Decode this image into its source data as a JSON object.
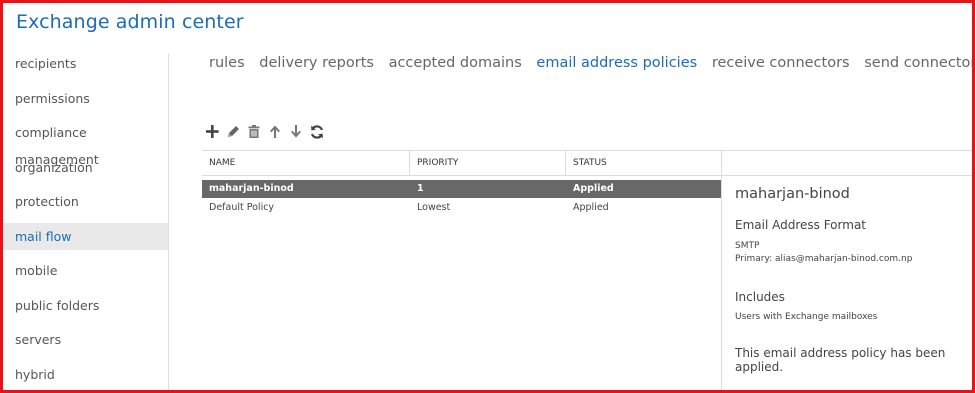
{
  "app": {
    "title": "Exchange admin center"
  },
  "sidebar": {
    "items": [
      {
        "label": "recipients"
      },
      {
        "label": "permissions"
      },
      {
        "label": "compliance management"
      },
      {
        "label": "organization"
      },
      {
        "label": "protection"
      },
      {
        "label": "mail flow",
        "active": true
      },
      {
        "label": "mobile"
      },
      {
        "label": "public folders"
      },
      {
        "label": "servers"
      },
      {
        "label": "hybrid"
      }
    ]
  },
  "tabs": [
    {
      "label": "rules"
    },
    {
      "label": "delivery reports"
    },
    {
      "label": "accepted domains"
    },
    {
      "label": "email address policies",
      "active": true
    },
    {
      "label": "receive connectors"
    },
    {
      "label": "send connectors"
    }
  ],
  "toolbar": {
    "icons": [
      "add-icon",
      "edit-icon",
      "delete-icon",
      "move-up-icon",
      "move-down-icon",
      "refresh-icon"
    ]
  },
  "table": {
    "columns": [
      "NAME",
      "PRIORITY",
      "STATUS"
    ],
    "rows": [
      {
        "name": "maharjan-binod",
        "priority": "1",
        "status": "Applied",
        "selected": true
      },
      {
        "name": "Default Policy",
        "priority": "Lowest",
        "status": "Applied"
      }
    ]
  },
  "details": {
    "name": "maharjan-binod",
    "format_heading": "Email Address Format",
    "format_type": "SMTP",
    "format_primary": "Primary: alias@maharjan-binod.com.np",
    "includes_heading": "Includes",
    "includes_value": "Users with Exchange mailboxes",
    "status_message": "This email address policy has been applied."
  },
  "colors": {
    "accent": "#1a6bb8",
    "frame": "#e8131a",
    "selected_row": "#686868"
  }
}
